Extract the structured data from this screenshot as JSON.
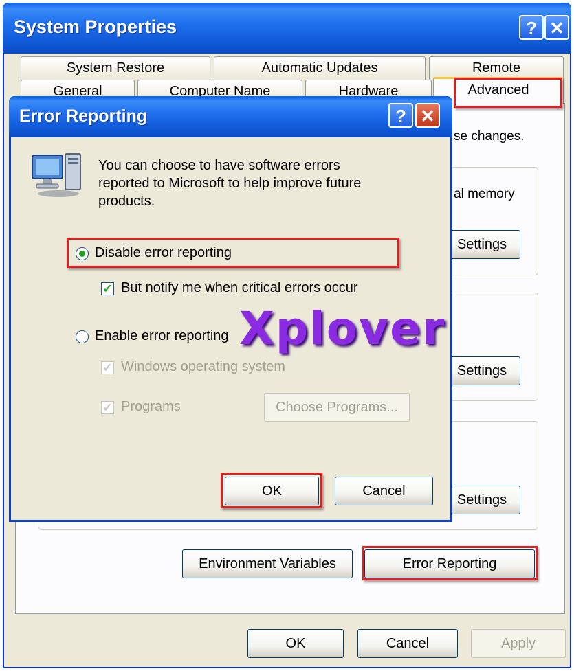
{
  "system_properties": {
    "title": "System Properties",
    "help_glyph": "?",
    "close_glyph": "✕",
    "tabs_row1": [
      "System Restore",
      "Automatic Updates",
      "Remote"
    ],
    "tabs_row2": [
      "General",
      "Computer Name",
      "Hardware"
    ],
    "active_tab": "Advanced",
    "panel_text_top": "se changes.",
    "panel_text_memory": "al memory",
    "settings_label": "Settings",
    "env_vars_button": "Environment Variables",
    "error_reporting_button": "Error Reporting",
    "ok_button": "OK",
    "cancel_button": "Cancel",
    "apply_button": "Apply"
  },
  "error_reporting_dialog": {
    "title": "Error Reporting",
    "help_glyph": "?",
    "close_glyph": "✕",
    "description_lines": [
      "You can choose to have software errors",
      "reported to Microsoft to help improve future",
      "products."
    ],
    "disable_option": "Disable error reporting",
    "notify_option": "But notify me when critical errors occur",
    "enable_option": "Enable error reporting",
    "windows_os_option": "Windows operating system",
    "programs_option": "Programs",
    "choose_programs_button": "Choose Programs...",
    "ok_button": "OK",
    "cancel_button": "Cancel",
    "selected_option": "disable",
    "notify_checked": true
  },
  "watermark": "Xplover",
  "colors": {
    "titlebar_blue": "#0a5fe8",
    "highlight_red": "#e02020",
    "watermark_purple": "#8a2be2",
    "dialog_face": "#ece9d8"
  },
  "icons": {
    "computer": "computer-icon"
  }
}
